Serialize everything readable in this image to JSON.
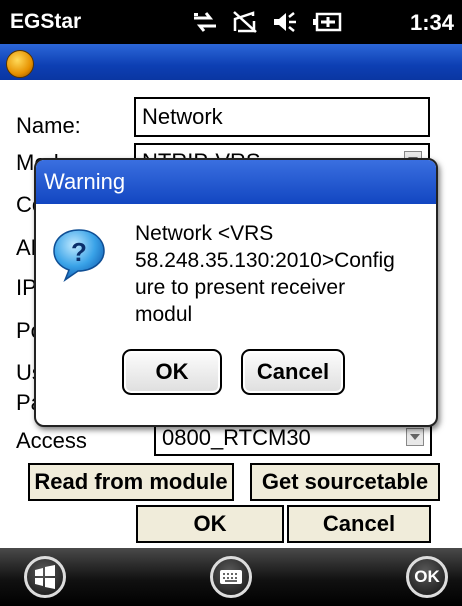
{
  "status_bar": {
    "app_name": "EGStar",
    "time": "1:34",
    "icons": [
      "network-sync-icon",
      "no-signal-icon",
      "volume-icon",
      "battery-icon"
    ]
  },
  "form": {
    "name_label": "Name:",
    "name_value": "Network",
    "mode_label": "Mode:",
    "mode_value": "NTRIP-VRS",
    "access_label": "Access",
    "access_value": "0800_RTCM30",
    "read_module_label": "Read from module",
    "get_sourcetable_label": "Get sourcetable",
    "ok_label": "OK",
    "cancel_label": "Cancel"
  },
  "hidden_label_fragments": [
    "Co",
    "AP",
    "IP",
    "Po",
    "Us",
    "Pa"
  ],
  "dialog": {
    "title": "Warning",
    "message_lines": [
      "Network <VRS",
      "58.248.35.130:2010>Config",
      "ure to present receiver",
      "modul"
    ],
    "ok_label": "OK",
    "cancel_label": "Cancel",
    "icon": "question-icon"
  },
  "taskbar": {
    "ok_label": "OK",
    "icons": [
      "windows-start-icon",
      "keyboard-icon",
      "ok-icon"
    ]
  },
  "colors": {
    "titlebar": "#0d3fb3",
    "button_bg": "#f0ecda",
    "dialog_title": "#1246c1"
  }
}
